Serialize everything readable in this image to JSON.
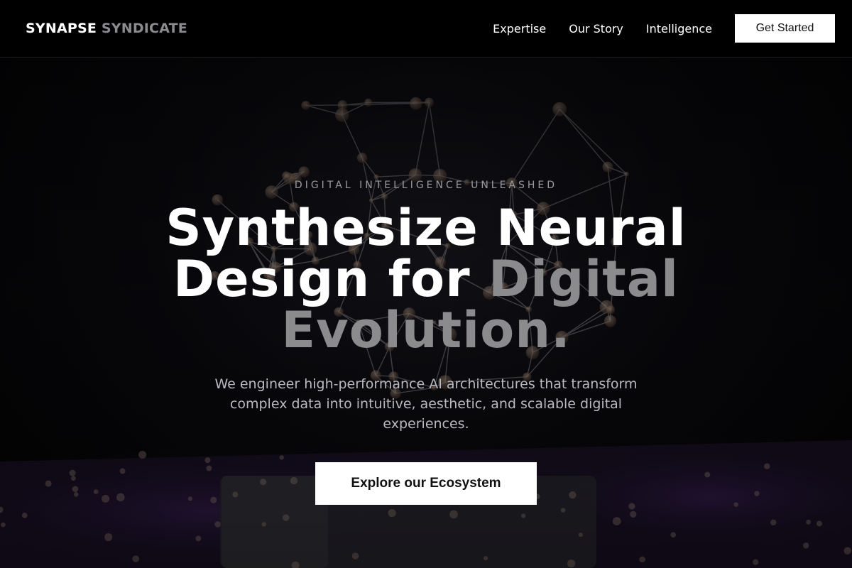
{
  "brand": {
    "name_part1": "SYNAPSE",
    "name_part2": "SYNDICATE"
  },
  "nav": {
    "links": [
      {
        "label": "Expertise"
      },
      {
        "label": "Our Story"
      },
      {
        "label": "Intelligence"
      }
    ],
    "cta_label": "Get Started"
  },
  "hero": {
    "eyebrow": "DIGITAL INTELLIGENCE UNLEASHED",
    "headline_main": "Synthesize Neural Design for ",
    "headline_accent": "Digital Evolution.",
    "subtext": "We engineer high-performance AI architectures that transform complex data into intuitive, aesthetic, and scalable digital experiences.",
    "cta_label": "Explore our Ecosystem"
  },
  "colors": {
    "background": "#050507",
    "header_bg": "#000000",
    "text_primary": "#ffffff",
    "text_muted": "#8a8a8f",
    "button_bg": "#ffffff",
    "button_text": "#111111",
    "glow_purple": "#3a1f5c"
  },
  "background_art": {
    "icon": "neural-sphere-network-icon"
  }
}
